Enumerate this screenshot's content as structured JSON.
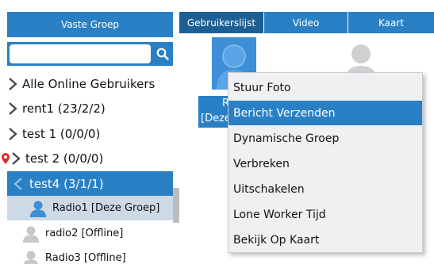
{
  "left_panel": {
    "header": "Vaste Groep",
    "search": {
      "value": "",
      "placeholder": ""
    },
    "tree": [
      {
        "label": "Alle Online Gebruikers",
        "icon": "chevron-right-icon"
      },
      {
        "label": "rent1 (23/2/2)",
        "icon": "chevron-right-icon"
      },
      {
        "label": "test 1 (0/0/0)",
        "icon": "chevron-right-icon"
      },
      {
        "label": "test 2 (0/0/0)",
        "icon": "chevron-right-icon",
        "marker": "location-pin-icon"
      },
      {
        "label": "test4 (3/1/1)",
        "icon": "chevron-left-icon",
        "selected": true
      }
    ],
    "users": [
      {
        "label": "Radio1 [Deze Groep]",
        "status": "online",
        "icon": "user-online-icon"
      },
      {
        "label": "radio2 [Offline]",
        "status": "offline",
        "icon": "user-offline-icon"
      },
      {
        "label": "Radio3 [Offline]",
        "status": "offline",
        "icon": "user-offline-icon"
      }
    ]
  },
  "tabs": [
    {
      "label": "Gebruikerslijst",
      "active": true
    },
    {
      "label": "Video",
      "active": false
    },
    {
      "label": "Kaart",
      "active": false
    }
  ],
  "user_tiles": {
    "selected_label_line1": "Ra",
    "selected_label_line2": "[Deze"
  },
  "context_menu": {
    "items": [
      "Stuur Foto",
      "Bericht Verzenden",
      "Dynamische Groep",
      "Verbreken",
      "Uitschakelen",
      "Lone Worker Tijd",
      "Bekijk Op Kaart"
    ],
    "highlighted_index": 1
  },
  "colors": {
    "accent": "#2a80c4",
    "accent_dark": "#1e5f93",
    "selected_row": "#cdd9e5",
    "online_user": "#3c8fd6",
    "offline_user": "#c8c8c8",
    "pin": "#e02828",
    "menu_bg": "#eef0f2"
  }
}
